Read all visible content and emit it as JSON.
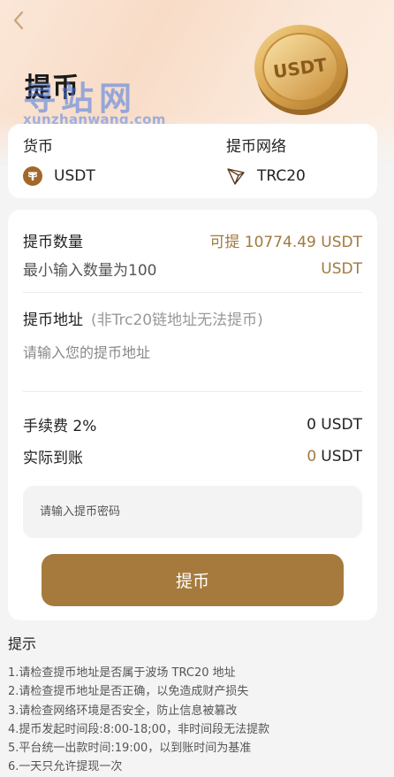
{
  "header": {
    "title": "提币",
    "watermark_main": "寻站网",
    "watermark_sub": "xunzhanwang.com",
    "coin_label": "USDT"
  },
  "network_card": {
    "currency_label": "货币",
    "currency_value": "USDT",
    "network_label": "提币网络",
    "network_value": "TRC20"
  },
  "withdraw": {
    "amount_label": "提币数量",
    "available": "可提 10774.49 USDT",
    "min_amount": "最小输入数量为100",
    "min_unit": "USDT",
    "address_label": "提币地址",
    "address_hint": "(非Trc20链地址无法提币)",
    "address_placeholder": "请输入您的提币地址",
    "address_value": "",
    "fee_label": "手续费 2%",
    "fee_value": "0 USDT",
    "received_label": "实际到账",
    "received_amount": "0",
    "received_unit": "USDT",
    "password_placeholder": "请输入提币密码",
    "password_value": "",
    "submit_label": "提币"
  },
  "tips": {
    "title": "提示",
    "lines": [
      "1.请检查提币地址是否属于波场 TRC20 地址",
      "2.请检查提币地址是否正确，以免造成财产损失",
      "3.请检查网络环境是否安全，防止信息被篡改",
      "4.提币发起时间段:8:00-18;00，非时间段无法提款",
      "5.平台统一出款时间:19:00，以到账时间为基准",
      "6.一天只允许提现一次"
    ]
  },
  "colors": {
    "accent": "#a67a3c",
    "gold_text": "#a07a3e",
    "background": "#f4f4f4"
  },
  "icons": {
    "back": "chevron-left-icon",
    "currency": "tether-icon",
    "network": "tron-icon",
    "hero_coin": "usdt-coin-icon"
  }
}
